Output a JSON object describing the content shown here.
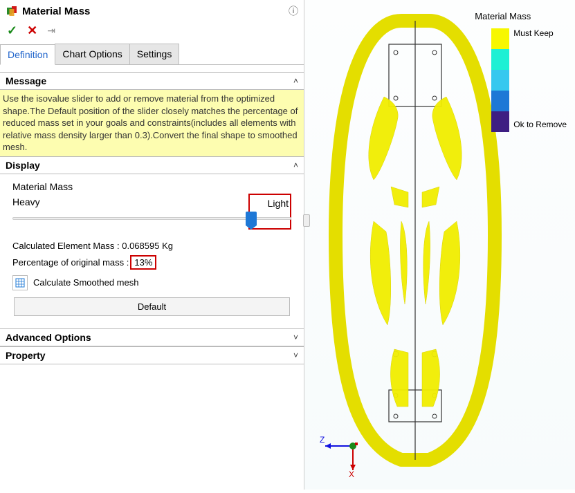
{
  "header": {
    "title": "Material Mass",
    "help_tooltip": "Help"
  },
  "actions": {
    "ok": "✓",
    "cancel": "✕",
    "pin": "⇥"
  },
  "tabs": {
    "definition": "Definition",
    "chart_options": "Chart Options",
    "settings": "Settings"
  },
  "sections": {
    "message": {
      "title": "Message",
      "body": "Use the isovalue slider to add or remove material from the optimized shape.The Default  position of the slider closely matches the percentage of reduced mass set in your goals and constraints(includes all elements with relative mass density larger than 0.3).Convert the final shape to smoothed mesh."
    },
    "display": {
      "title": "Display",
      "subhead": "Material Mass",
      "slider": {
        "heavy": "Heavy",
        "light": "Light",
        "value_pct": 87
      },
      "calc_mass_label": "Calculated Element Mass : 0.068595 Kg",
      "pct_label": "Percentage of original mass :",
      "pct_value": "13%",
      "smooth_label": "Calculate Smoothed mesh",
      "default_btn": "Default"
    },
    "advanced": {
      "title": "Advanced Options"
    },
    "property": {
      "title": "Property"
    }
  },
  "viewport": {
    "legend_title": "Material Mass",
    "legend_top": "Must Keep",
    "legend_bottom": "Ok to Remove",
    "triad": {
      "x": "X",
      "z": "Z"
    }
  },
  "colors": {
    "highlight_red": "#c00",
    "model_yellow": "#f1ee00"
  }
}
